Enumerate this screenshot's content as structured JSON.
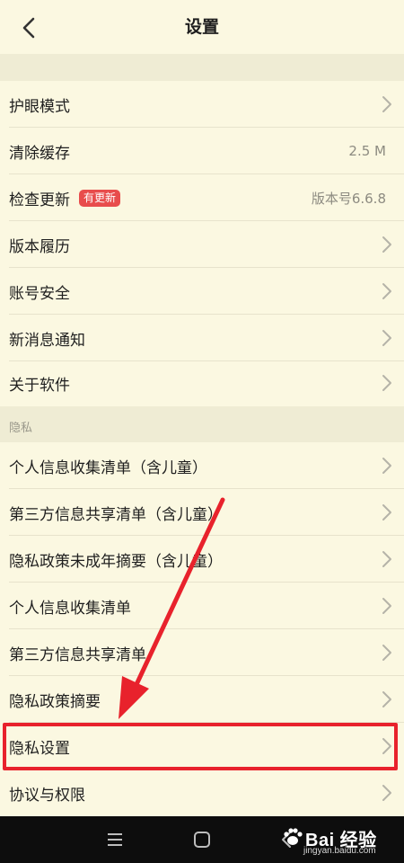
{
  "header": {
    "title": "设置",
    "back_icon": "chevron-left-icon"
  },
  "settings": [
    {
      "label": "护眼模式",
      "chevron": true
    },
    {
      "label": "清除缓存",
      "value": "2.5 M",
      "chevron": false
    },
    {
      "label": "检查更新",
      "badge": "有更新",
      "value": "版本号6.6.8",
      "chevron": false
    },
    {
      "label": "版本履历",
      "chevron": true
    },
    {
      "label": "账号安全",
      "chevron": true
    },
    {
      "label": "新消息通知",
      "chevron": true
    },
    {
      "label": "关于软件",
      "chevron": true
    }
  ],
  "privacy_section": {
    "title": "隐私",
    "items": [
      {
        "label": "个人信息收集清单（含儿童）"
      },
      {
        "label": "第三方信息共享清单（含儿童）"
      },
      {
        "label": "隐私政策未成年摘要（含儿童）"
      },
      {
        "label": "个人信息收集清单"
      },
      {
        "label": "第三方信息共享清单"
      },
      {
        "label": "隐私政策摘要"
      },
      {
        "label": "隐私设置",
        "highlighted": true
      },
      {
        "label": "协议与权限"
      }
    ]
  },
  "annotation": {
    "color": "#e8222c"
  },
  "nav_bar": {
    "menu_icon": "menu-icon",
    "home_icon": "home-icon",
    "back_icon": "back-icon"
  },
  "watermark": {
    "brand": "Bai 经验",
    "url": "jingyan.baidu.com",
    "icon": "paw-icon"
  },
  "colors": {
    "background": "#fbf8e1",
    "section_band": "#efecd4",
    "badge": "#e84c4c"
  }
}
